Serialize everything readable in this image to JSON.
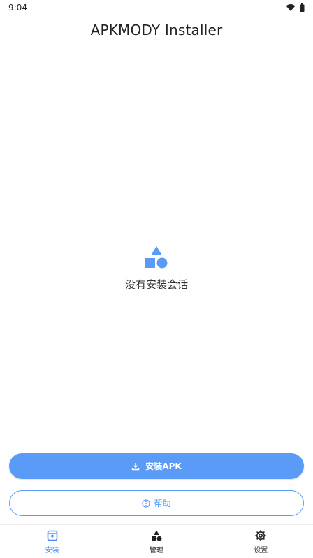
{
  "status_bar": {
    "time": "9:04",
    "icons": [
      "wifi-icon",
      "battery-icon"
    ]
  },
  "app": {
    "title": "APKMODY Installer"
  },
  "empty_state": {
    "icon": "shapes-icon",
    "text": "没有安装会话"
  },
  "actions": {
    "install_apk_label": "安装APK",
    "install_icon": "download-icon",
    "help_label": "帮助",
    "help_icon": "help-circle-icon"
  },
  "bottom_nav": {
    "active": "install",
    "items": [
      {
        "id": "install",
        "label": "安装",
        "icon": "install-box-icon"
      },
      {
        "id": "manage",
        "label": "管理",
        "icon": "shapes-icon"
      },
      {
        "id": "settings",
        "label": "设置",
        "icon": "gear-icon"
      }
    ]
  },
  "colors": {
    "accent": "#5b9bf8",
    "active_nav": "#4a8af4",
    "background": "#ffffff"
  }
}
